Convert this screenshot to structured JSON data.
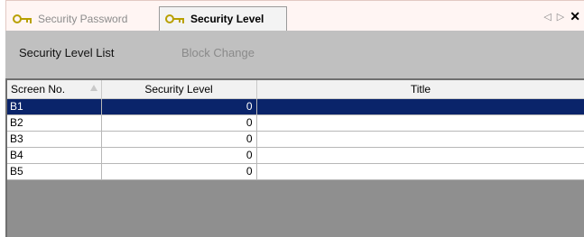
{
  "tabs": [
    {
      "label": "Security Password",
      "icon": "key-icon",
      "active": false
    },
    {
      "label": "Security Level",
      "icon": "key-icon",
      "active": true
    }
  ],
  "tab_nav": {
    "prev": "◁",
    "next": "▷",
    "close": "✕"
  },
  "toolbar": {
    "list_label": "Security Level List",
    "block_change_label": "Block Change"
  },
  "table": {
    "columns": [
      "Screen No.",
      "Security Level",
      "Title"
    ],
    "rows": [
      {
        "screen": "B1",
        "level": "0",
        "title": ""
      },
      {
        "screen": "B2",
        "level": "0",
        "title": ""
      },
      {
        "screen": "B3",
        "level": "0",
        "title": ""
      },
      {
        "screen": "B4",
        "level": "0",
        "title": ""
      },
      {
        "screen": "B5",
        "level": "0",
        "title": ""
      }
    ],
    "selected_row": 0
  },
  "colors": {
    "selection": "#0a246a",
    "toolbar_bg": "#c0c0c0",
    "empty_area": "#8f8f8f",
    "key_icon": "#b8a000"
  }
}
